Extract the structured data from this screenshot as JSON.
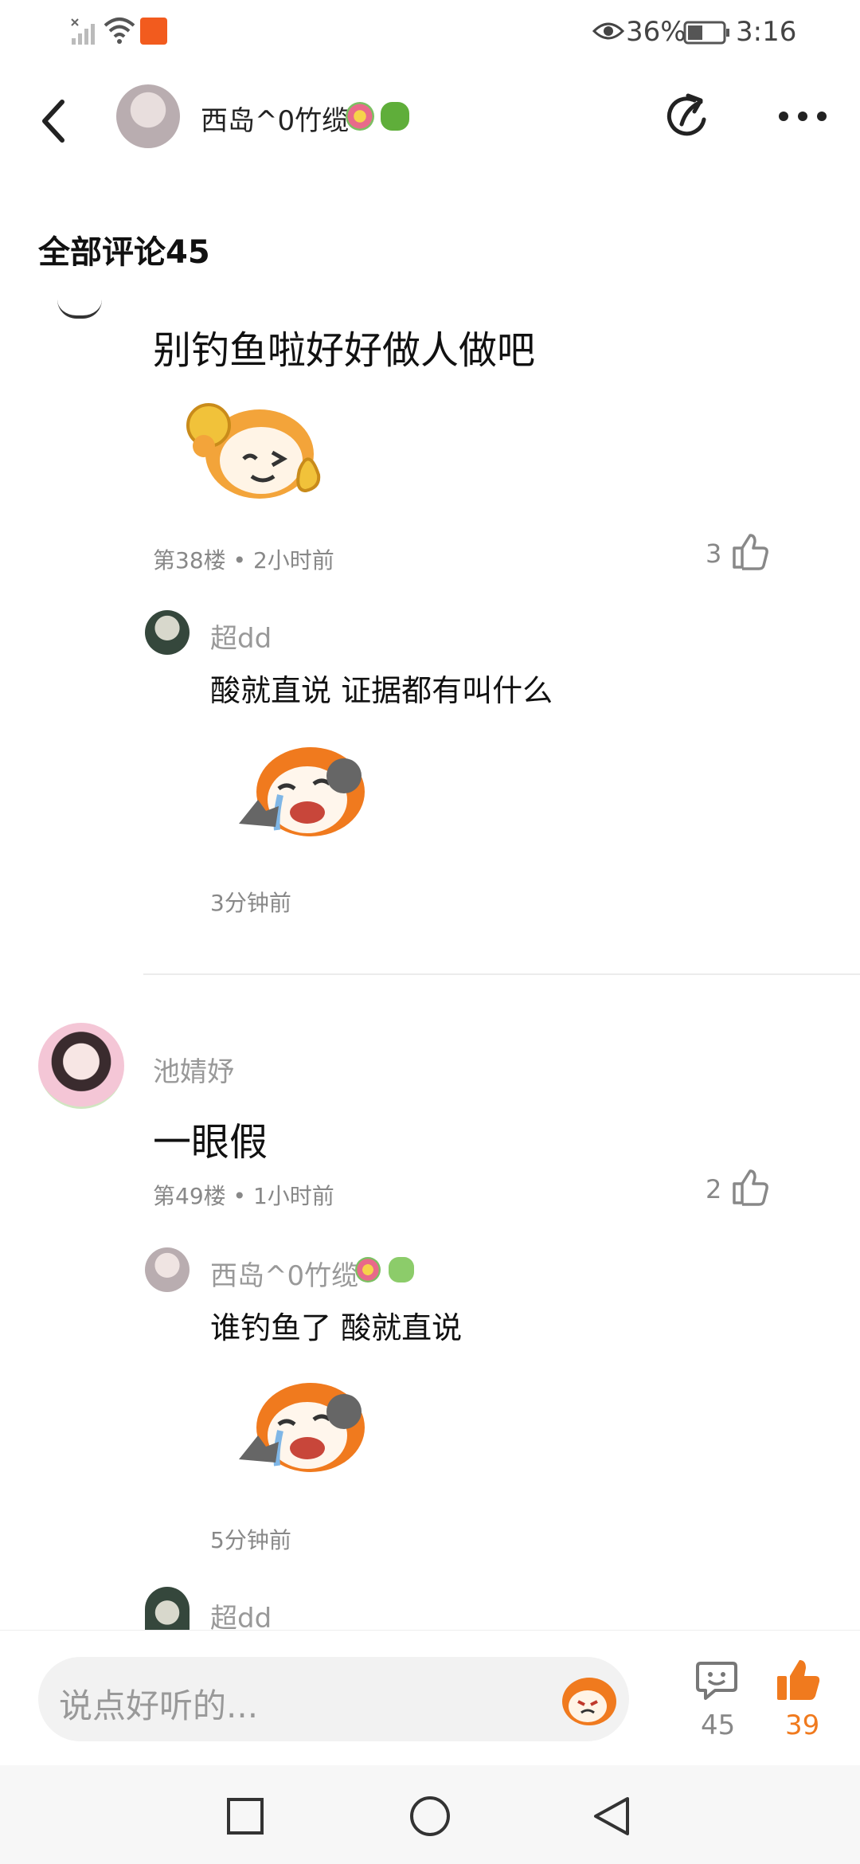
{
  "status_bar": {
    "battery_percent": "36%",
    "time": "3:16"
  },
  "header": {
    "title": "西岛^0竹缆"
  },
  "section": {
    "title": "全部评论45"
  },
  "comments": [
    {
      "text": "别钓鱼啦好好做人做吧",
      "meta": "第38楼 • 2小时前",
      "likes": "3",
      "replies": [
        {
          "username": "超dd",
          "text": "酸就直说  证据都有叫什么",
          "time": "3分钟前"
        }
      ]
    },
    {
      "username": "池婧妤",
      "text": "一眼假",
      "meta": "第49楼 • 1小时前",
      "likes": "2",
      "replies": [
        {
          "username": "西岛^0竹缆",
          "text": "谁钓鱼了 酸就直说",
          "time": "5分钟前"
        },
        {
          "username": "超dd"
        }
      ]
    }
  ],
  "bottom_bar": {
    "placeholder": "说点好听的...",
    "comment_count": "45",
    "like_count": "39"
  },
  "colors": {
    "accent": "#f07a1e",
    "text": "#111111",
    "meta": "#888888"
  },
  "icons": [
    "back-icon",
    "share-icon",
    "more-icon",
    "like-icon",
    "comment-icon",
    "emoji-icon",
    "wifi-icon",
    "signal-icon",
    "eye-icon",
    "battery-icon",
    "nav-square-icon",
    "nav-circle-icon",
    "nav-back-icon",
    "sticker-icon",
    "flower-icon",
    "clover-icon"
  ]
}
